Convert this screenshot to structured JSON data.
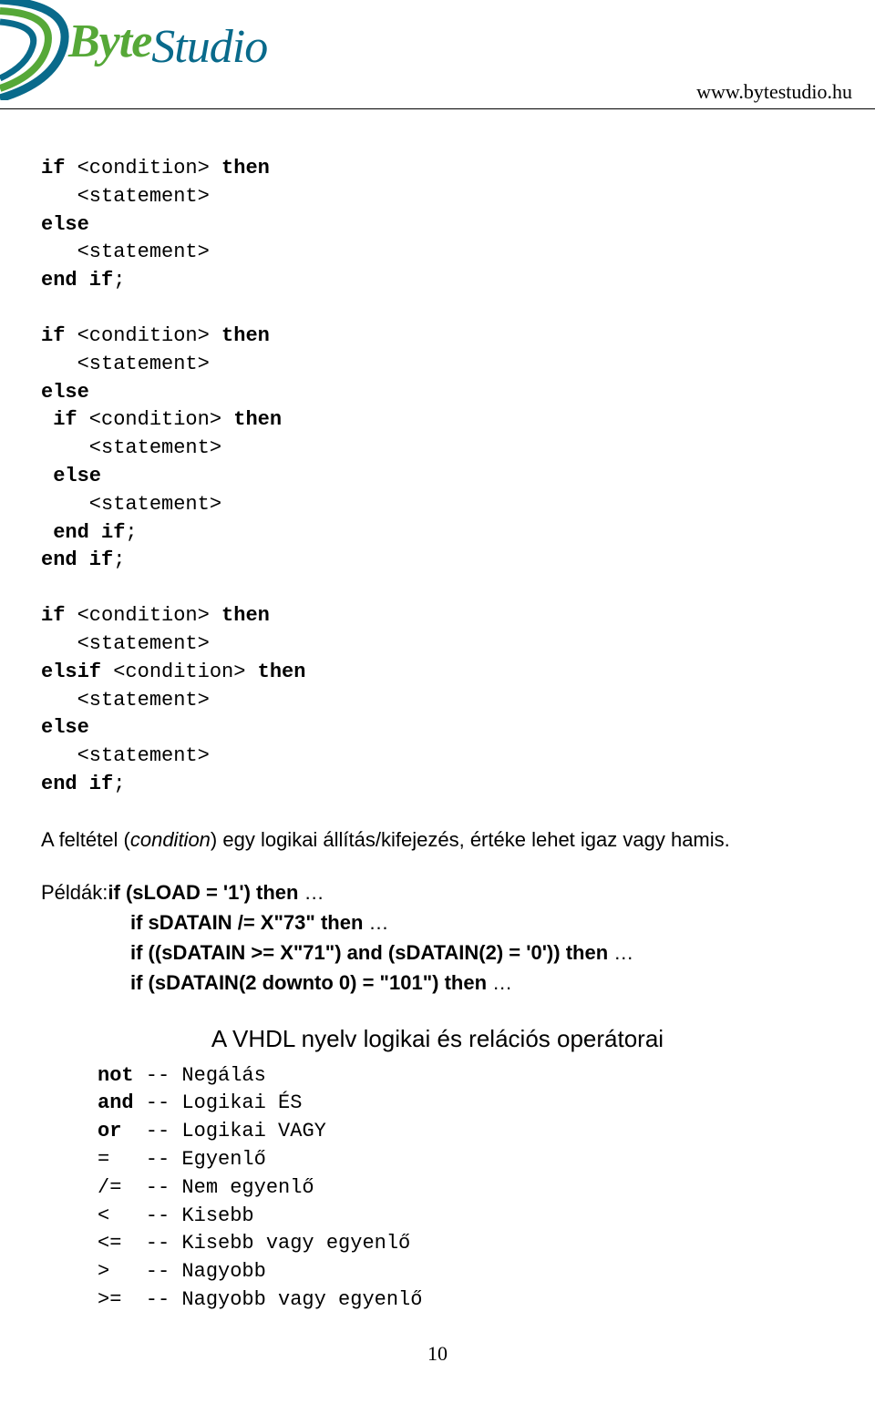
{
  "header": {
    "logo_part1": "Byte",
    "logo_part2": "Studio",
    "url": "www.bytestudio.hu"
  },
  "code_block1": "if <condition> then\n   <statement>\nelse\n   <statement>\nend if;",
  "code_block2": "if <condition> then\n   <statement>\nelse\n if <condition> then\n    <statement>\n else\n    <statement>\n end if;\nend if;",
  "code_block3": "if <condition> then\n   <statement>\nelsif <condition> then\n   <statement>\nelse\n   <statement>\nend if;",
  "paragraph": {
    "pre": "A feltétel (",
    "italic": "condition",
    "post": ") egy logikai állítás/kifejezés, értéke lehet igaz vagy hamis."
  },
  "examples": {
    "label": "Példák:",
    "line1_pre": "if (sLOAD = '1') ",
    "line1_b": "then",
    "line2_pre": "if sDATAIN /= X\"73\" ",
    "line2_b": "then",
    "line3_pre": "if ((sDATAIN >= X\"71\") ",
    "line3_b1": "and",
    "line3_mid": " (sDATAIN(2) = '0')) ",
    "line3_b2": "then",
    "line4_pre": "if (sDATAIN(2 downto 0) = \"101\") ",
    "line4_b": "then",
    "ellipsis": " …"
  },
  "section_title": "A VHDL nyelv logikai és relációs operátorai",
  "operators": "not -- Negálás\nand -- Logikai ÉS\nor  -- Logikai VAGY\n=   -- Egyenlő\n/=  -- Nem egyenlő\n<   -- Kisebb\n<=  -- Kisebb vagy egyenlő\n>   -- Nagyobb\n>=  -- Nagyobb vagy egyenlő",
  "page_number": "10"
}
